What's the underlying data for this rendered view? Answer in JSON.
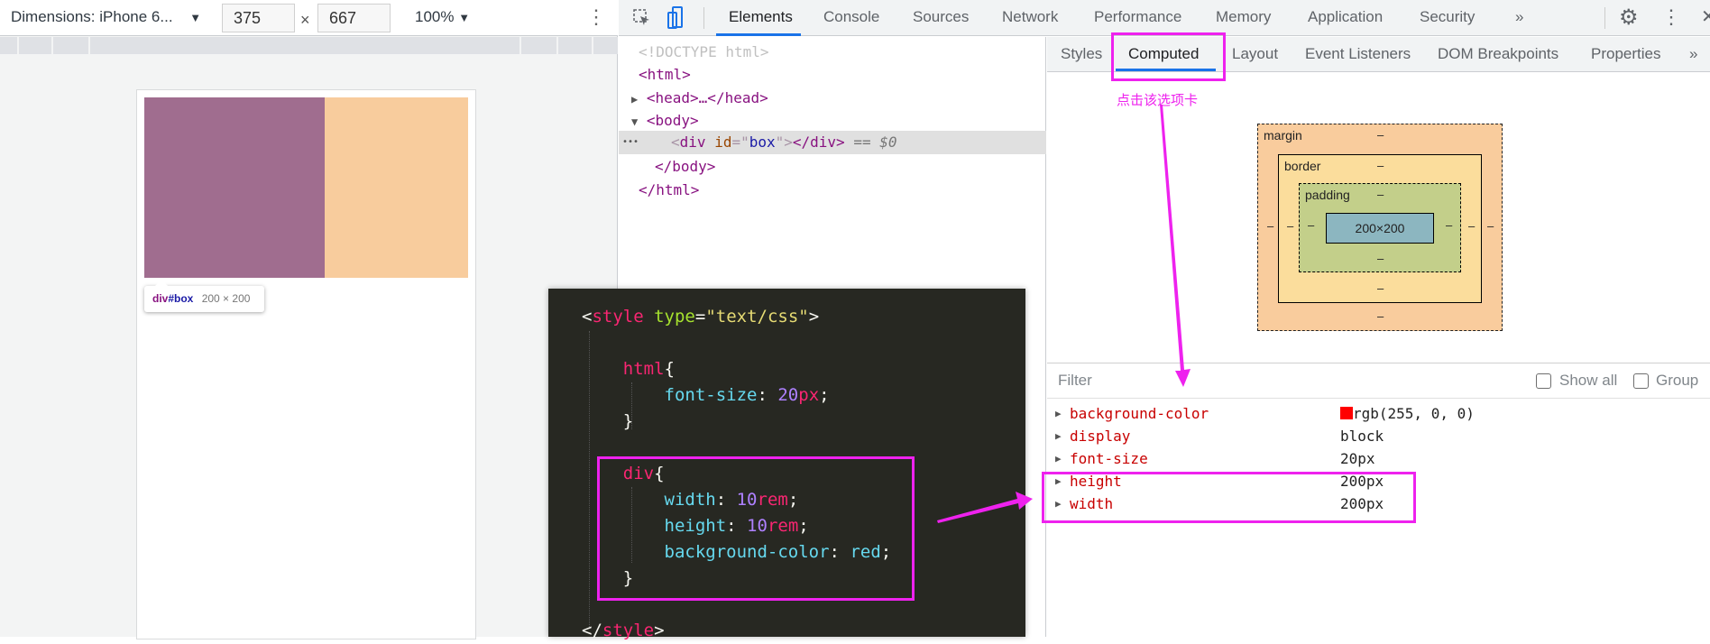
{
  "device_toolbar": {
    "dimensions_label": "Dimensions: iPhone 6...",
    "width_value": "375",
    "times": "×",
    "height_value": "667",
    "zoom_label": "100%",
    "dropdown_arrow": "▼",
    "more_icon": "⋮"
  },
  "preview": {
    "tooltip_tag": "div",
    "tooltip_id": "#box",
    "tooltip_size": "200 × 200",
    "content_color": "#a06d8f",
    "margin_color": "#f8cc9d"
  },
  "devtools": {
    "tabs": [
      "Elements",
      "Console",
      "Sources",
      "Network",
      "Performance",
      "Memory",
      "Application",
      "Security"
    ],
    "active_tab": "Elements",
    "more_tabs": "»",
    "accent": "#1a73e8"
  },
  "elements_tree": {
    "doctype": "<!DOCTYPE html>",
    "html_open": "<html>",
    "head": "<head>…</head>",
    "body_open": "<body>",
    "selected": {
      "tag": "div",
      "attr": "id",
      "value": "box",
      "close": "</div>",
      "marker": "== $0",
      "dots": "•••"
    },
    "body_close": "</body>",
    "html_close": "</html>"
  },
  "sidebar": {
    "tabs": [
      "Styles",
      "Computed",
      "Layout",
      "Event Listeners",
      "DOM Breakpoints",
      "Properties"
    ],
    "active_tab": "Computed",
    "more_tabs": "»",
    "annotation": "点击该选项卡",
    "box_model": {
      "margin_label": "margin",
      "border_label": "border",
      "padding_label": "padding",
      "content_size": "200×200",
      "empty": "–"
    },
    "filter_placeholder": "Filter",
    "show_all_label": "Show all",
    "group_label": "Group",
    "properties": [
      {
        "name": "background-color",
        "value": "rgb(255, 0, 0)",
        "swatch": "#ff0000"
      },
      {
        "name": "display",
        "value": "block"
      },
      {
        "name": "font-size",
        "value": "20px"
      },
      {
        "name": "height",
        "value": "200px"
      },
      {
        "name": "width",
        "value": "200px"
      }
    ]
  },
  "code": {
    "lines": [
      [
        [
          "<",
          "pl"
        ],
        [
          "style",
          "kw"
        ],
        [
          " ",
          "pl"
        ],
        [
          "type",
          "at"
        ],
        [
          "=",
          "pl"
        ],
        [
          "\"text/css\"",
          "st"
        ],
        [
          ">",
          "pl"
        ]
      ],
      [],
      [
        [
          "    ",
          "pl"
        ],
        [
          "html",
          "kw"
        ],
        [
          "{",
          "pl"
        ]
      ],
      [
        [
          "        ",
          "pl"
        ],
        [
          "font-size",
          "pr"
        ],
        [
          ": ",
          "pl"
        ],
        [
          "20",
          "nu"
        ],
        [
          "px",
          "kw"
        ],
        [
          ";",
          "pl"
        ]
      ],
      [
        [
          "    ",
          "pl"
        ],
        [
          "}",
          "pl"
        ]
      ],
      [],
      [
        [
          "    ",
          "pl"
        ],
        [
          "div",
          "kw"
        ],
        [
          "{",
          "pl"
        ]
      ],
      [
        [
          "        ",
          "pl"
        ],
        [
          "width",
          "pr"
        ],
        [
          ": ",
          "pl"
        ],
        [
          "10",
          "nu"
        ],
        [
          "rem",
          "kw"
        ],
        [
          ";",
          "pl"
        ]
      ],
      [
        [
          "        ",
          "pl"
        ],
        [
          "height",
          "pr"
        ],
        [
          ": ",
          "pl"
        ],
        [
          "10",
          "nu"
        ],
        [
          "rem",
          "kw"
        ],
        [
          ";",
          "pl"
        ]
      ],
      [
        [
          "        ",
          "pl"
        ],
        [
          "background-color",
          "pr"
        ],
        [
          ": ",
          "pl"
        ],
        [
          "red",
          "pr"
        ],
        [
          ";",
          "pl"
        ]
      ],
      [
        [
          "    ",
          "pl"
        ],
        [
          "}",
          "pl"
        ]
      ],
      [],
      [
        [
          "</",
          "pl"
        ],
        [
          "style",
          "kw"
        ],
        [
          ">",
          "pl"
        ]
      ]
    ]
  },
  "highlight_color": "#ee22ee"
}
